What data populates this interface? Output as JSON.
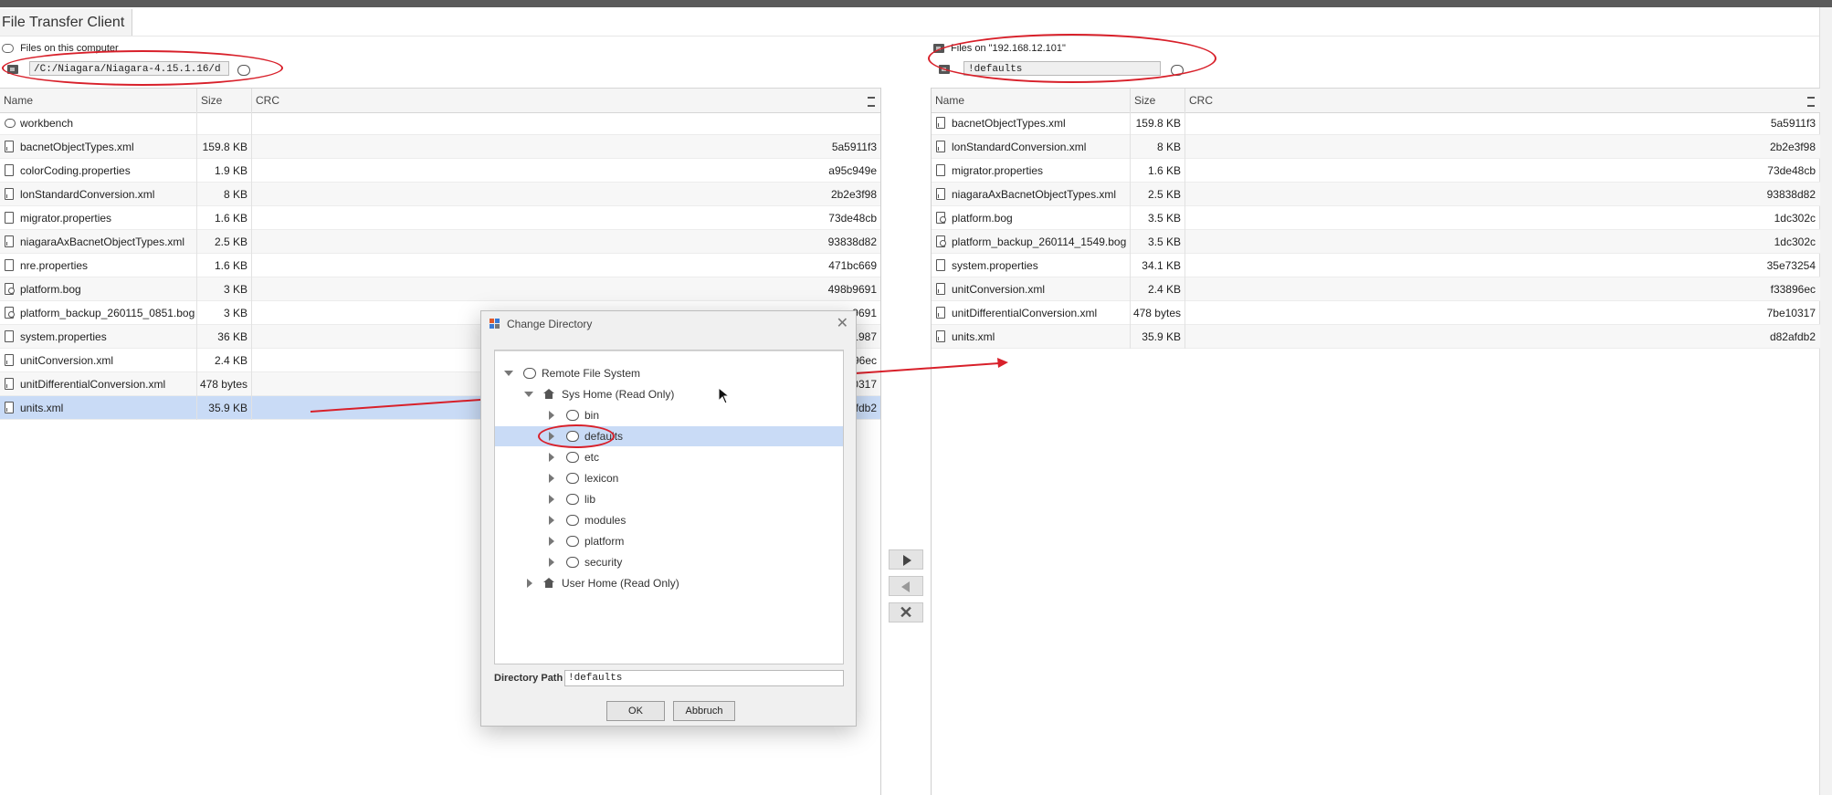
{
  "window": {
    "title": "File Transfer Client"
  },
  "left_panel": {
    "label": "Files on this computer",
    "path": "/C:/Niagara/Niagara-4.15.1.16/d",
    "columns": [
      "Name",
      "Size",
      "CRC"
    ],
    "rows": [
      {
        "name": "workbench",
        "size": "",
        "crc": "",
        "type": "dir"
      },
      {
        "name": "bacnetObjectTypes.xml",
        "size": "159.8 KB",
        "crc": "5a5911f3",
        "type": "xml"
      },
      {
        "name": "colorCoding.properties",
        "size": "1.9 KB",
        "crc": "a95c949e",
        "type": "file"
      },
      {
        "name": "lonStandardConversion.xml",
        "size": "8 KB",
        "crc": "2b2e3f98",
        "type": "xml"
      },
      {
        "name": "migrator.properties",
        "size": "1.6 KB",
        "crc": "73de48cb",
        "type": "file"
      },
      {
        "name": "niagaraAxBacnetObjectTypes.xml",
        "size": "2.5 KB",
        "crc": "93838d82",
        "type": "xml"
      },
      {
        "name": "nre.properties",
        "size": "1.6 KB",
        "crc": "471bc669",
        "type": "file"
      },
      {
        "name": "platform.bog",
        "size": "3 KB",
        "crc": "498b9691",
        "type": "bog"
      },
      {
        "name": "platform_backup_260115_0851.bog",
        "size": "3 KB",
        "crc": "9691",
        "type": "bog"
      },
      {
        "name": "system.properties",
        "size": "36 KB",
        "crc": "1987",
        "type": "file"
      },
      {
        "name": "unitConversion.xml",
        "size": "2.4 KB",
        "crc": "96ec",
        "type": "xml"
      },
      {
        "name": "unitDifferentialConversion.xml",
        "size": "478 bytes",
        "crc": "10317",
        "type": "xml"
      },
      {
        "name": "units.xml",
        "size": "35.9 KB",
        "crc": "fdb2",
        "type": "xml",
        "selected": true
      }
    ]
  },
  "right_panel": {
    "label": "Files on \"192.168.12.101\"",
    "path": "!defaults",
    "columns": [
      "Name",
      "Size",
      "CRC"
    ],
    "rows": [
      {
        "name": "bacnetObjectTypes.xml",
        "size": "159.8 KB",
        "crc": "5a5911f3",
        "type": "xml"
      },
      {
        "name": "lonStandardConversion.xml",
        "size": "8 KB",
        "crc": "2b2e3f98",
        "type": "xml"
      },
      {
        "name": "migrator.properties",
        "size": "1.6 KB",
        "crc": "73de48cb",
        "type": "file"
      },
      {
        "name": "niagaraAxBacnetObjectTypes.xml",
        "size": "2.5 KB",
        "crc": "93838d82",
        "type": "xml"
      },
      {
        "name": "platform.bog",
        "size": "3.5 KB",
        "crc": "1dc302c",
        "type": "bog"
      },
      {
        "name": "platform_backup_260114_1549.bog",
        "size": "3.5 KB",
        "crc": "1dc302c",
        "type": "bog"
      },
      {
        "name": "system.properties",
        "size": "34.1 KB",
        "crc": "35e73254",
        "type": "file"
      },
      {
        "name": "unitConversion.xml",
        "size": "2.4 KB",
        "crc": "f33896ec",
        "type": "xml"
      },
      {
        "name": "unitDifferentialConversion.xml",
        "size": "478 bytes",
        "crc": "7be10317",
        "type": "xml"
      },
      {
        "name": "units.xml",
        "size": "35.9 KB",
        "crc": "d82afdb2",
        "type": "xml"
      }
    ]
  },
  "dialog": {
    "title": "Change Directory",
    "tree": {
      "root": "Remote File System",
      "sys_home": "Sys Home (Read Only)",
      "folders": [
        "bin",
        "defaults",
        "etc",
        "lexicon",
        "lib",
        "modules",
        "platform",
        "security"
      ],
      "selected_folder": "defaults",
      "user_home": "User Home (Read Only)"
    },
    "path_label": "Directory Path",
    "path_value": "!defaults",
    "ok_label": "OK",
    "cancel_label": "Abbruch"
  },
  "colors": {
    "selection": "#c9dbf6",
    "annotation_red": "#d8202a"
  }
}
